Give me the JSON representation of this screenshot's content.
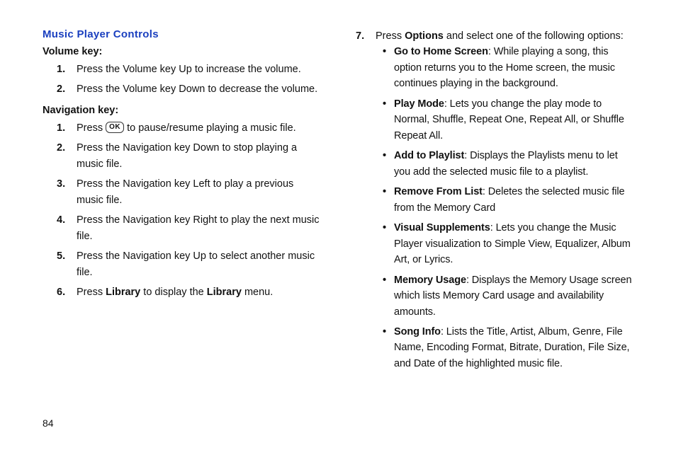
{
  "heading": "Music Player Controls",
  "volumeKey": {
    "label": "Volume key",
    "items": [
      {
        "num": "1.",
        "text": "Press the Volume key Up to increase the volume."
      },
      {
        "num": "2.",
        "text": "Press the Volume key Down to decrease the volume."
      }
    ]
  },
  "navKey": {
    "label": "Navigation key",
    "items": [
      {
        "num": "1.",
        "prefix": "Press ",
        "okLabel": "OK",
        "suffix": " to pause/resume playing a music file."
      },
      {
        "num": "2.",
        "text": "Press the Navigation key Down to stop playing a music file."
      },
      {
        "num": "3.",
        "text": "Press the Navigation key Left to play a previous music file."
      },
      {
        "num": "4.",
        "text": "Press the Navigation key Right to play the next music file."
      },
      {
        "num": "5.",
        "text": "Press the Navigation key Up to select another music file."
      },
      {
        "num": "6.",
        "prefix": "Press ",
        "bold1": "Library",
        "mid": " to display the ",
        "bold2": "Library",
        "suffix": " menu."
      }
    ]
  },
  "right": {
    "num": "7.",
    "prefix": "Press ",
    "bold": "Options",
    "suffix": " and select one of the following options:",
    "bullets": [
      {
        "bold": "Go to Home Screen",
        "text": ": While playing a song, this option returns you to the Home screen, the music continues playing in the background."
      },
      {
        "bold": "Play Mode",
        "text": ": Lets you change the play mode to Normal, Shuffle, Repeat One, Repeat All, or Shuffle Repeat All."
      },
      {
        "bold": "Add to Playlist",
        "text": ": Displays the Playlists menu to let you add the selected music file to a playlist."
      },
      {
        "bold": "Remove From List",
        "text": ": Deletes the selected music file from the Memory Card"
      },
      {
        "bold": "Visual Supplements",
        "text": ": Lets you change the Music Player visualization to Simple View, Equalizer, Album Art, or Lyrics."
      },
      {
        "bold": "Memory Usage",
        "text": ": Displays the Memory Usage screen which lists Memory Card usage and availability amounts."
      },
      {
        "bold": "Song Info",
        "text": ": Lists the Title, Artist, Album, Genre, File Name, Encoding Format, Bitrate, Duration, File Size, and Date of the highlighted music file."
      }
    ]
  },
  "pageNum": "84"
}
